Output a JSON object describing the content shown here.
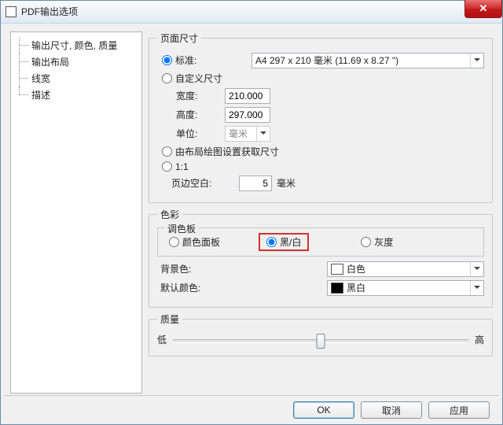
{
  "window": {
    "title": "PDF输出选项"
  },
  "tree": {
    "items": [
      {
        "label": "输出尺寸, 颜色, 质量"
      },
      {
        "label": "输出布局"
      },
      {
        "label": "线宽"
      },
      {
        "label": "描述"
      }
    ]
  },
  "page_size": {
    "legend": "页面尺寸",
    "standard_label": "标准:",
    "standard_value": "A4 297 x 210 毫米 (11.69 x 8.27 \")",
    "custom_label": "自定义尺寸",
    "width_label": "宽度:",
    "width_value": "210.000",
    "height_label": "高度:",
    "height_value": "297.000",
    "unit_label": "单位:",
    "unit_value": "毫米",
    "from_layout_label": "由布局绘图设置获取尺寸",
    "one_to_one_label": "1:1",
    "margin_label": "页边空白:",
    "margin_value": "5",
    "margin_unit": "毫米"
  },
  "color": {
    "legend": "色彩",
    "palette_label": "调色板",
    "palette_options": {
      "color_panel": "颜色面板",
      "black_white": "黑/白",
      "gray": "灰度"
    },
    "bg_label": "背景色:",
    "bg_value": "白色",
    "default_color_label": "默认颜色:",
    "default_color_value": "黑白"
  },
  "quality": {
    "legend": "质量",
    "low_label": "低",
    "high_label": "高"
  },
  "buttons": {
    "ok": "OK",
    "cancel": "取消",
    "apply": "应用"
  }
}
